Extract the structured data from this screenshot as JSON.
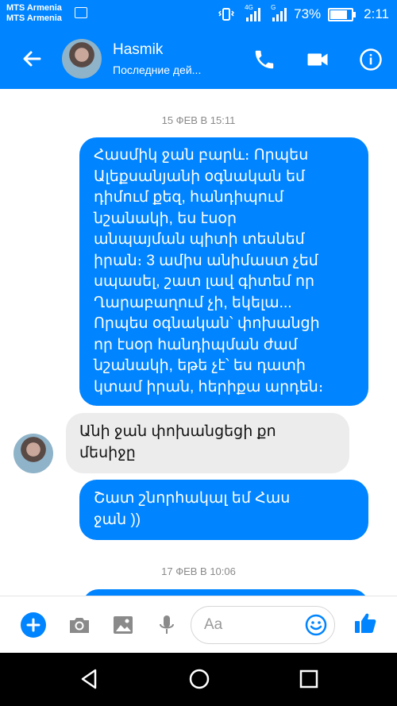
{
  "statusbar": {
    "carrier1": "MTS Armenia",
    "carrier2": "MTS Armenia",
    "net1": "4G",
    "net2": "G",
    "battery_pct": "73%",
    "battery_level": 0.73,
    "time": "2:11"
  },
  "header": {
    "name": "Hasmik",
    "subtitle": "Последние дей...",
    "icons": [
      "back-arrow-icon",
      "phone-icon",
      "video-camera-icon",
      "info-icon"
    ]
  },
  "chat": {
    "timestamp1": "15 ФЕВ В 15:11",
    "messages": [
      {
        "dir": "out",
        "lines": [
          "Հասմիկ ջան բարև։ Որպես",
          "Ալեքսանյանի օգնական եմ",
          "դիմում քեզ, հանդիպում",
          "նշանակի, ես էսօր",
          "անպայման պիտի տեսնեմ",
          "իրան։ 3 ամիս անիմաստ չեմ",
          "սպասել, շատ լավ գիտեմ որ",
          "Ղարաբաղում չի, եկելա...",
          "Որպես օգնական՝ փոխանցի",
          "որ էսօր հանդիպման ժամ",
          "նշանակի, եթե չէ՝ ես դատի",
          "կտամ իրան, հերիքա արդեն։"
        ]
      },
      {
        "dir": "in",
        "lines": [
          "Անի ջան փոխանցեցի քո",
          "մեսիջը"
        ]
      },
      {
        "dir": "out",
        "lines": [
          "Շատ շնորհակալ եմ Հաս",
          "ջան ))"
        ]
      }
    ],
    "timestamp2": "17 ФЕВ В 10:06"
  },
  "composer": {
    "placeholder": "Aa",
    "icons": [
      "plus-icon",
      "camera-icon",
      "gallery-icon",
      "microphone-icon",
      "emoji-icon",
      "thumbs-up-icon"
    ]
  },
  "navbar": {
    "icons": [
      "nav-back-icon",
      "nav-home-icon",
      "nav-recents-icon"
    ]
  },
  "colors": {
    "accent": "#0084ff",
    "incoming_bubble": "#ececec"
  }
}
